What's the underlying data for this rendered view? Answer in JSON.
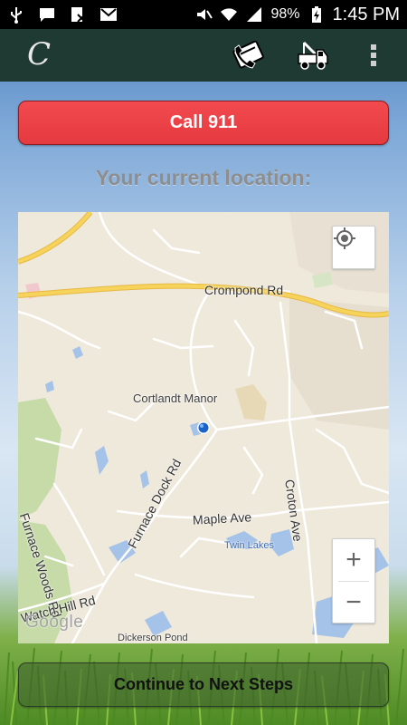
{
  "status_bar": {
    "icons": [
      "usb-icon",
      "chat-icon",
      "missed-call-icon",
      "gmail-icon",
      "mute-icon",
      "wifi-icon",
      "signal-icon",
      "battery-charging-icon"
    ],
    "battery": "98%",
    "time": "1:45 PM"
  },
  "action_bar": {
    "logo": "C",
    "actions": [
      "phone-card-icon",
      "tow-truck-icon",
      "overflow-menu-icon"
    ]
  },
  "call_button": {
    "label": "Call 911"
  },
  "location": {
    "title": "Your current location:"
  },
  "map": {
    "labels": {
      "crompond": "Crompond Rd",
      "cortlandt": "Cortlandt Manor",
      "furnace_woods": "Furnace Woods Rd",
      "furnace_dock": "Furnace Dock Rd",
      "maple": "Maple Ave",
      "croton": "Croton Ave",
      "twin_lakes": "Twin Lakes",
      "watch_hill": "Watch Hill Rd",
      "dickerson": "Dickerson Pond"
    },
    "attribution": "Google",
    "zoom_in": "+",
    "zoom_out": "−"
  },
  "next_button": {
    "label": "Continue to Next Steps"
  },
  "colors": {
    "call_red": "#e53a3f",
    "action_bar": "#1f3a33",
    "map_road_major": "#f6d35a",
    "map_water": "#a5c2e8",
    "map_park": "#c6dba8"
  }
}
